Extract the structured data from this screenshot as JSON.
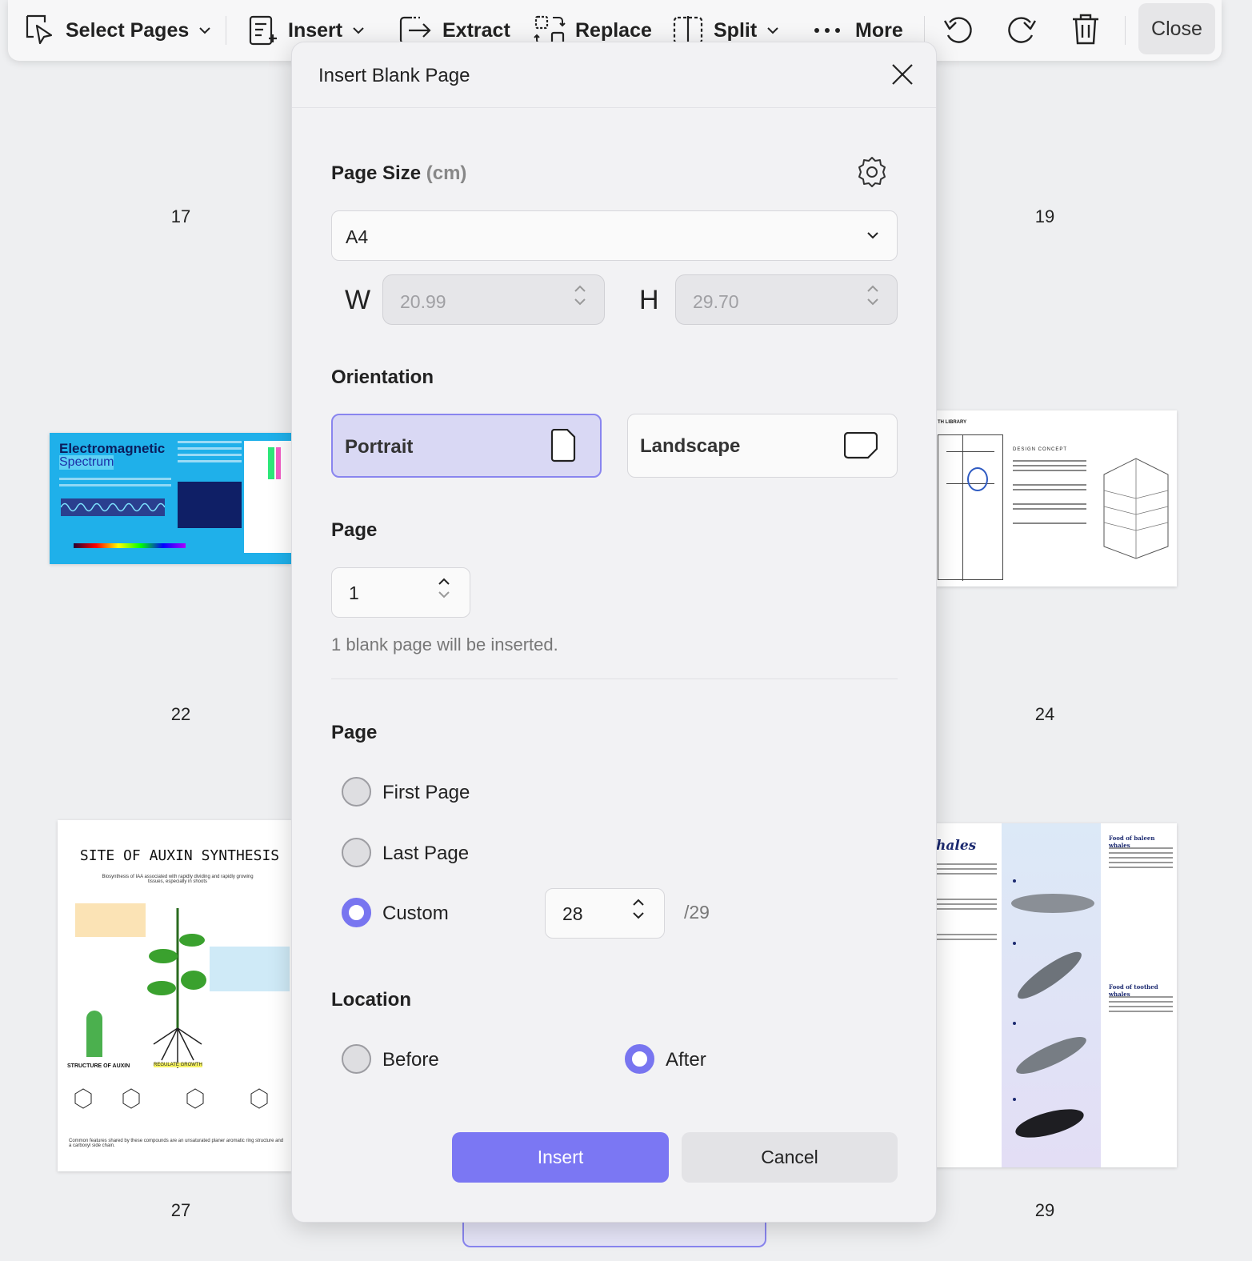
{
  "toolbar": {
    "select_pages": "Select Pages",
    "insert": "Insert",
    "extract": "Extract",
    "replace": "Replace",
    "split": "Split",
    "more": "More",
    "close": "Close"
  },
  "pages": {
    "numbers": [
      "17",
      "19",
      "22",
      "24",
      "27",
      "29"
    ],
    "thumb_17_title": "Electromagnetic",
    "thumb_17_subtitle": "Spectrum",
    "thumb_19_header": "TH LIBRARY",
    "thumb_19_concept": "DESIGN CONCEPT",
    "thumb_22_title": "SITE OF AUXIN SYNTHESIS",
    "thumb_22_subtitle": "Biosynthesis of IAA associated with rapidly dividing and rapidly growing tissues, especially in shoots",
    "thumb_22_structure": "STRUCTURE OF AUXIN",
    "thumb_22_regulate": "REGULATE GROWTH",
    "thumb_22_footer": "Common features shared by these compounds are an unsaturated planer aromatic ring structure and a carboxyl side chain.",
    "thumb_24_title": "hales",
    "thumb_24_food_baleen": "Food of baleen whales",
    "thumb_24_food_toothed": "Food of toothed whales"
  },
  "dialog": {
    "title": "Insert Blank Page",
    "page_size_label": "Page Size",
    "page_size_unit": "(cm)",
    "page_size_value": "A4",
    "width_letter": "W",
    "width_value": "20.99",
    "height_letter": "H",
    "height_value": "29.70",
    "orientation_label": "Orientation",
    "portrait": "Portrait",
    "landscape": "Landscape",
    "orientation_selected": "Portrait",
    "page_count_label": "Page",
    "page_count_value": "1",
    "info_text": "1 blank page will be inserted.",
    "position_label": "Page",
    "first_page": "First Page",
    "last_page": "Last Page",
    "custom": "Custom",
    "position_selected": "Custom",
    "custom_value": "28",
    "custom_total": "/29",
    "location_label": "Location",
    "before": "Before",
    "after": "After",
    "location_selected": "After",
    "insert_button": "Insert",
    "cancel_button": "Cancel"
  },
  "colors": {
    "accent": "#7b77f3",
    "selected_bg": "#d9d8f4"
  }
}
